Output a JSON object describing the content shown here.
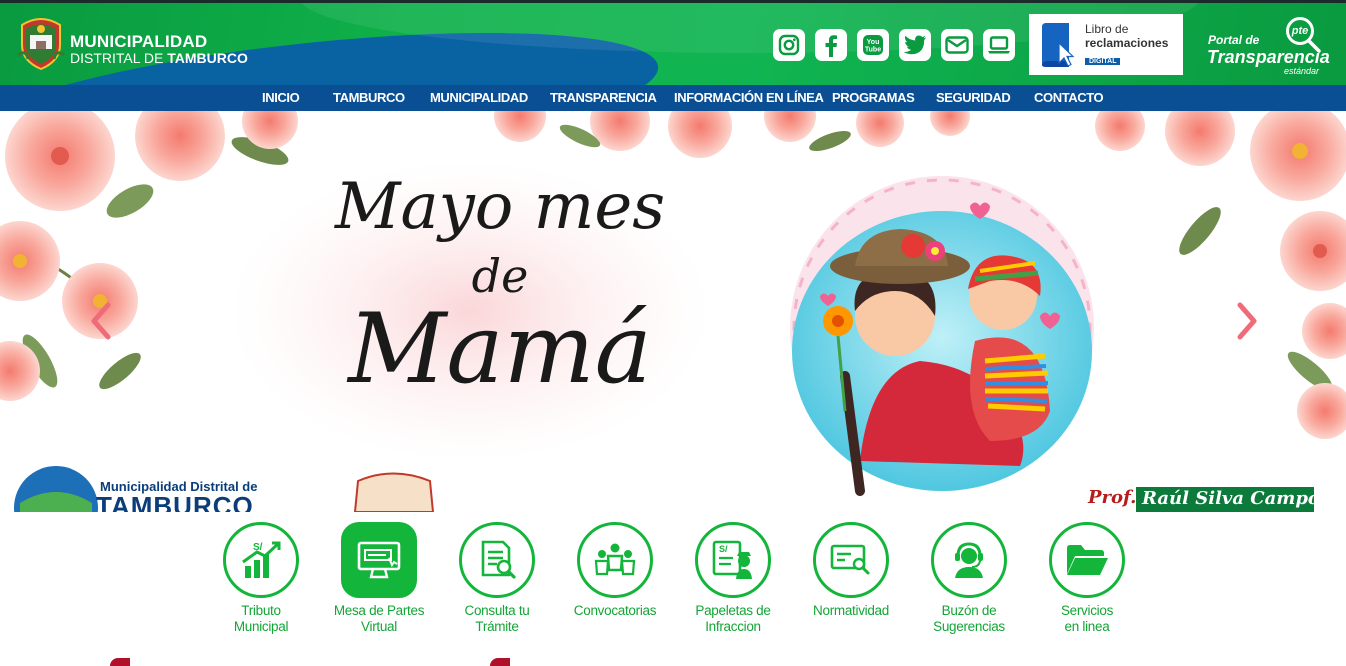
{
  "header": {
    "brand_line1": "MUNICIPALIDAD",
    "brand_line2_prefix": "DISTRITAL DE ",
    "brand_line2_bold": "TAMBURCO",
    "social_icons": [
      "instagram-icon",
      "facebook-icon",
      "youtube-icon",
      "twitter-icon",
      "mail-icon",
      "laptop-icon"
    ],
    "youtube_text": "You\nTube",
    "libro": {
      "line1": "Libro de",
      "line2": "reclamaciones",
      "line3": "DIGITAL"
    },
    "portal": {
      "line1": "Portal de",
      "line2": "Transparencia",
      "line3": "estándar",
      "badge": "pte"
    }
  },
  "nav": {
    "items": [
      "INICIO",
      "TAMBURCO",
      "MUNICIPALIDAD",
      "TRANSPARENCIA",
      "INFORMACIÓN EN LÍNEA",
      "PROGRAMAS",
      "SEGURIDAD",
      "CONTACTO"
    ]
  },
  "banner": {
    "line1": "Mayo mes",
    "line2": "de",
    "line3": "Mamá",
    "footer_left_1": "Municipalidad Distrital de",
    "footer_left_2": "TAMBURCO",
    "footer_right_prefix": "Prof.",
    "footer_right_name": "Raúl Silva Campos"
  },
  "services": [
    {
      "line1": "Tributo",
      "line2": "Municipal",
      "icon": "tax-chart-icon"
    },
    {
      "line1": "Mesa de Partes",
      "line2": "Virtual",
      "icon": "virtual-desk-icon"
    },
    {
      "line1": "Consulta tu",
      "line2": "Trámite",
      "icon": "document-search-icon"
    },
    {
      "line1": "Convocatorias",
      "line2": "",
      "icon": "people-icon"
    },
    {
      "line1": "Papeletas de",
      "line2": "Infraccion",
      "icon": "ticket-officer-icon"
    },
    {
      "line1": "Normatividad",
      "line2": "",
      "icon": "card-search-icon"
    },
    {
      "line1": "Buzón de",
      "line2": "Sugerencias",
      "icon": "headset-icon"
    },
    {
      "line1": "Servicios",
      "line2": "en linea",
      "icon": "folder-icon"
    }
  ],
  "colors": {
    "green": "#13b53a",
    "blue": "#0a4f93",
    "pink": "#f06b7a"
  }
}
